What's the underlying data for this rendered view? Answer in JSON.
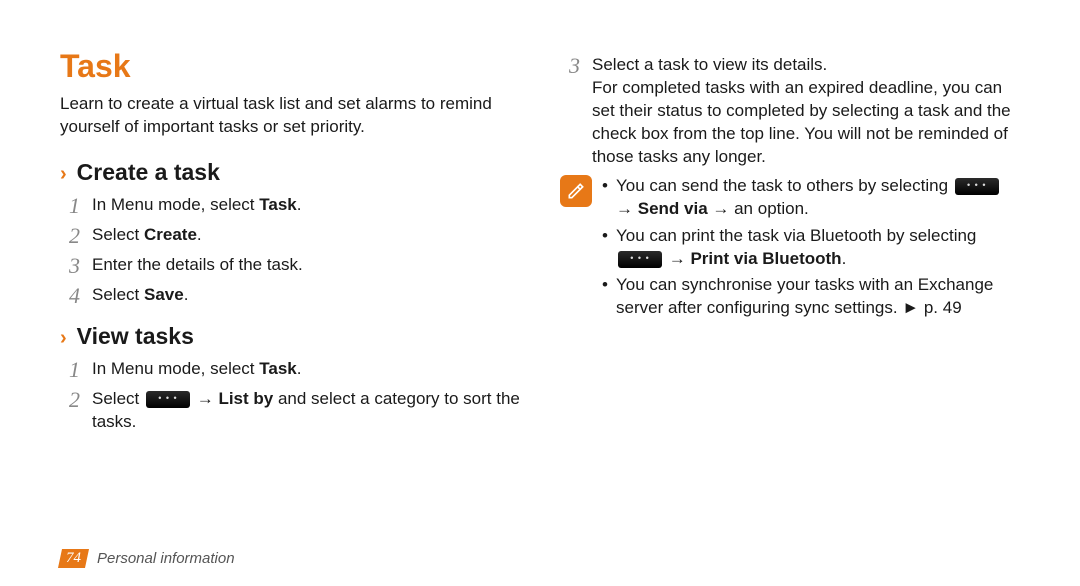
{
  "title": "Task",
  "intro": "Learn to create a virtual task list and set alarms to remind yourself of important tasks or set priority.",
  "section_create": {
    "heading": "Create a task",
    "steps": {
      "s1_pre": "In Menu mode, select ",
      "s1_bold": "Task",
      "s1_post": ".",
      "s2_pre": "Select ",
      "s2_bold": "Create",
      "s2_post": ".",
      "s3": "Enter the details of the task.",
      "s4_pre": "Select ",
      "s4_bold": "Save",
      "s4_post": "."
    }
  },
  "section_view": {
    "heading": "View tasks",
    "steps": {
      "s1_pre": "In Menu mode, select ",
      "s1_bold": "Task",
      "s1_post": ".",
      "s2_pre": "Select ",
      "s2_arrow": " → ",
      "s2_bold": "List by",
      "s2_post": " and select a category to sort the tasks."
    }
  },
  "col2": {
    "s3_a": "Select a task to view its details.",
    "s3_b": "For completed tasks with an expired deadline, you can set their status to completed by selecting a task and the check box from the top line. You will not be reminded of those tasks any longer.",
    "notes": {
      "n1_pre": "You can send the task to others by selecting ",
      "n1_arrow": " → ",
      "n1_bold": "Send via",
      "n1_post": " → an option.",
      "n2_pre": "You can print the task via Bluetooth by selecting ",
      "n2_arrow": " → ",
      "n2_bold": "Print via Bluetooth",
      "n2_post": ".",
      "n3": "You can synchronise your tasks with an Exchange server after configuring sync settings. ► p. 49"
    }
  },
  "footer": {
    "page": "74",
    "section": "Personal information"
  }
}
